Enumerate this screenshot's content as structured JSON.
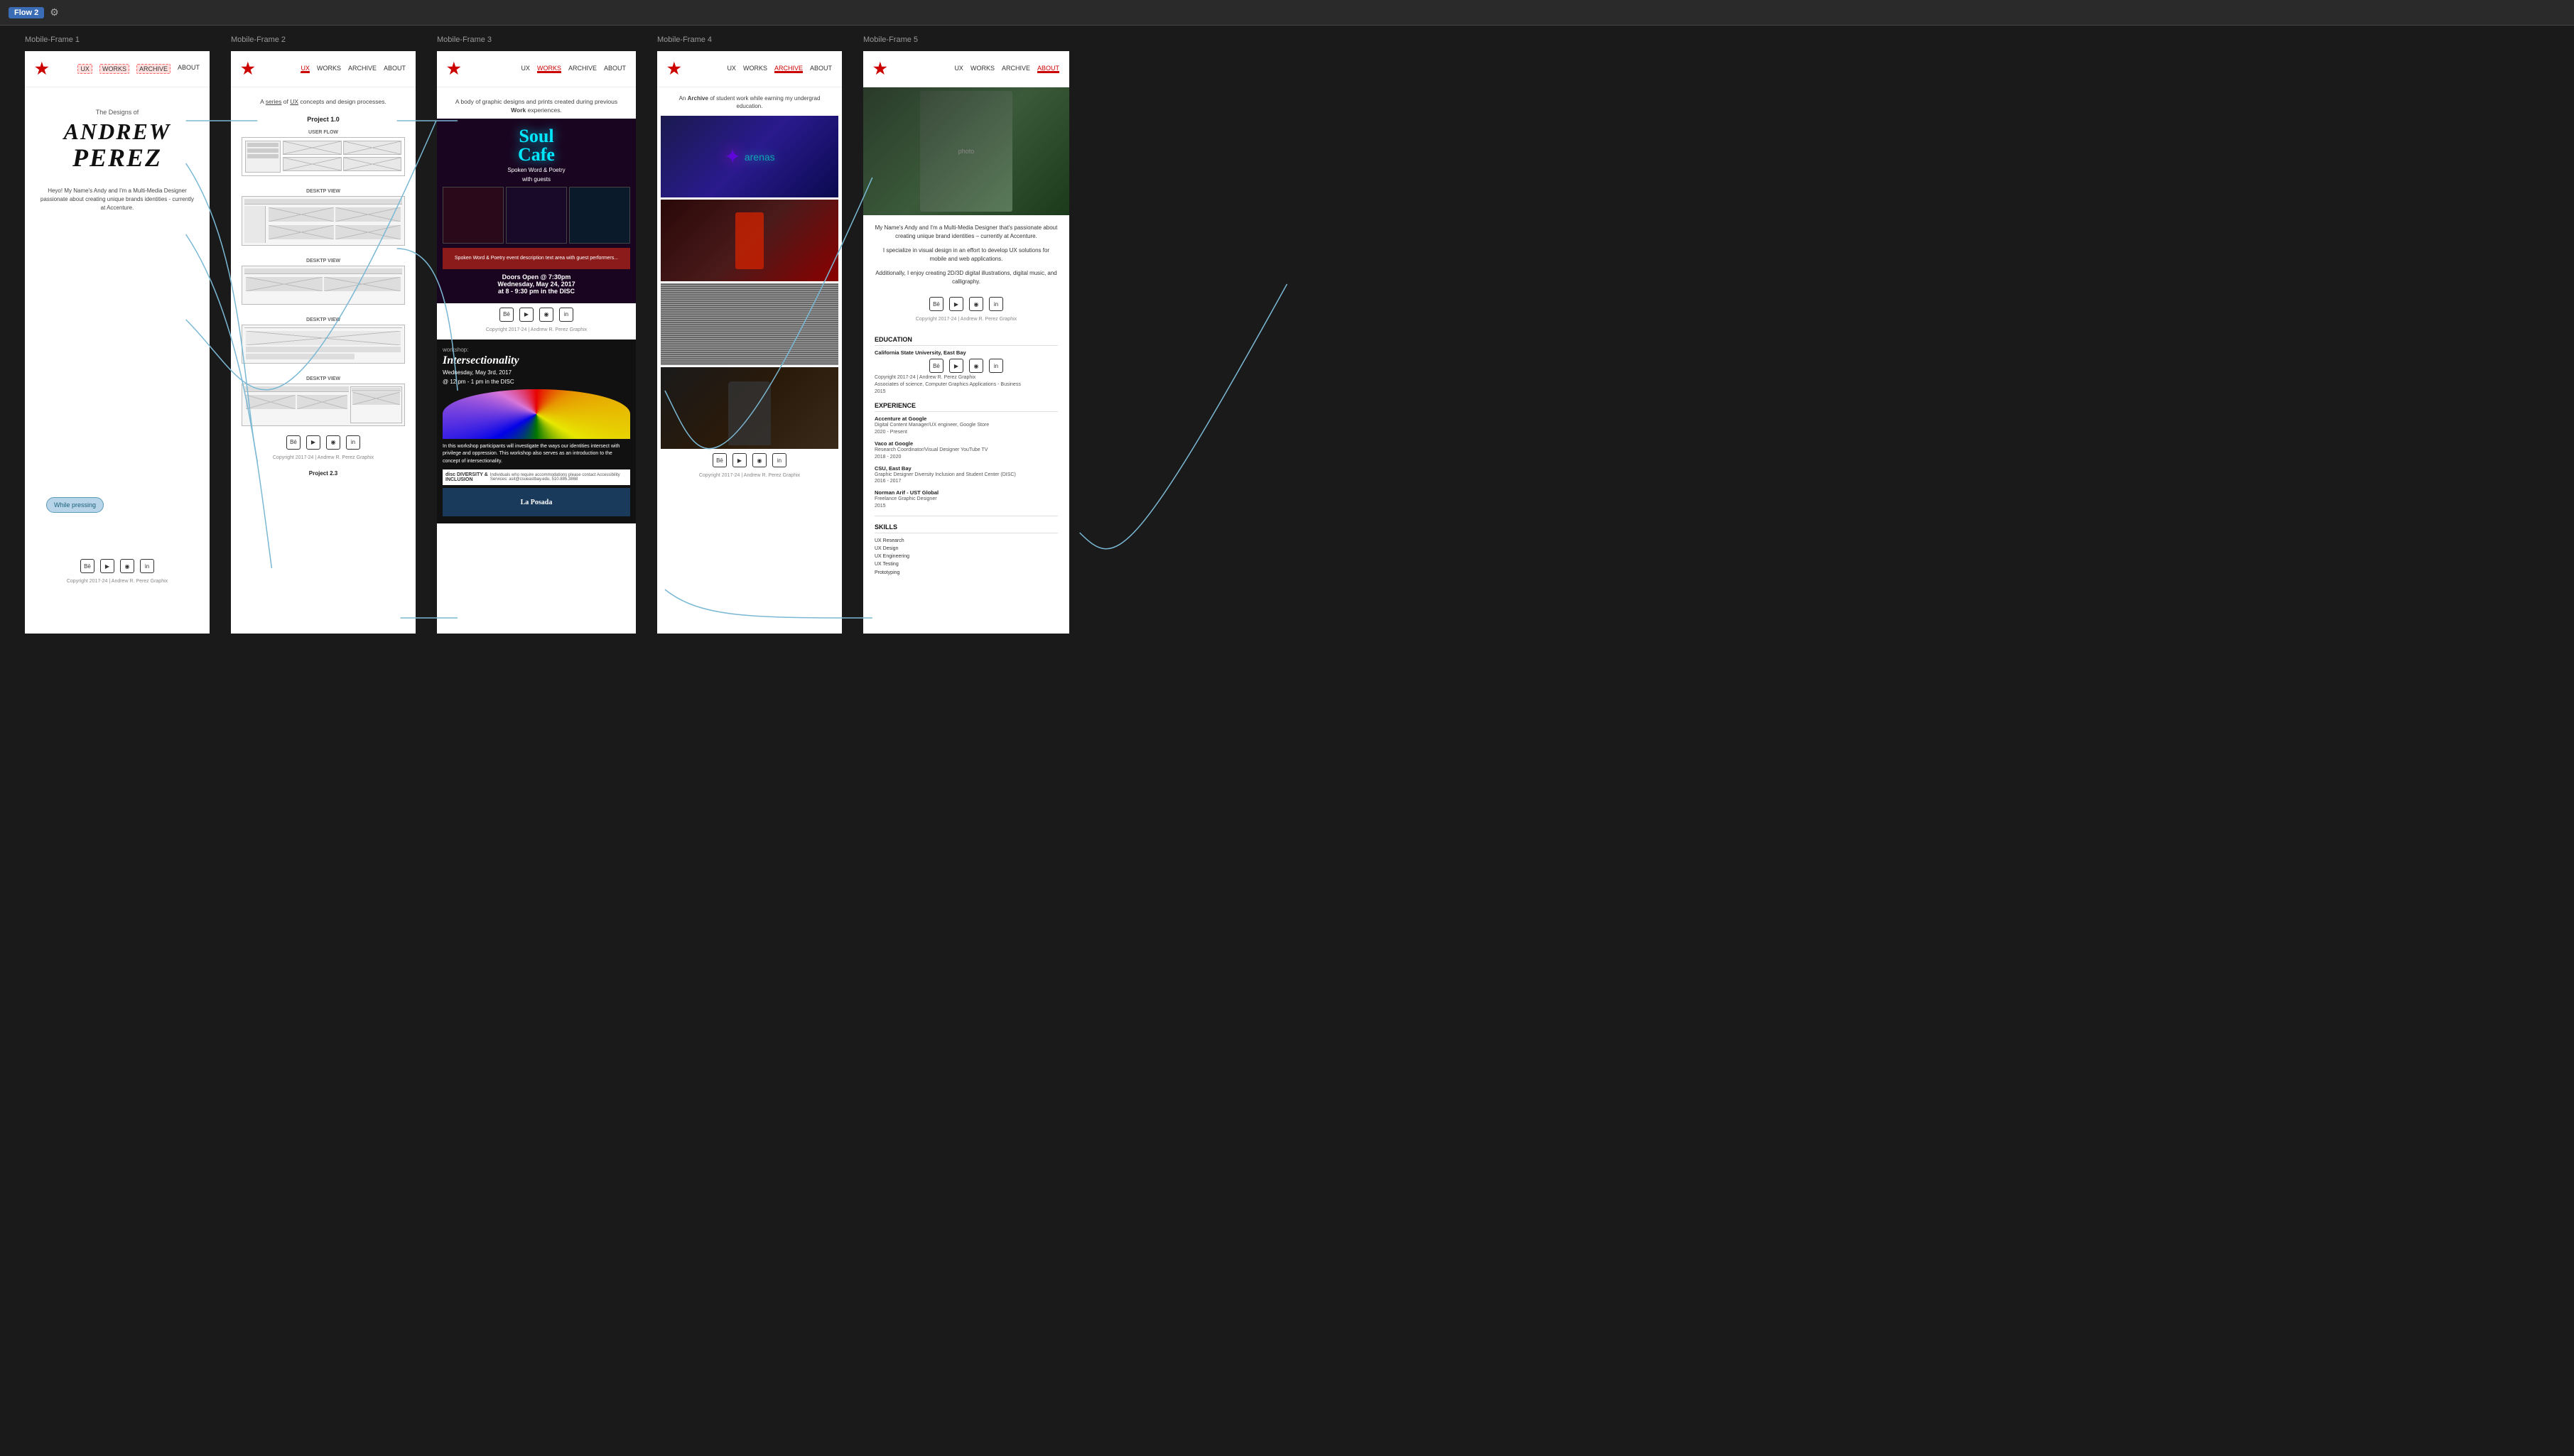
{
  "topbar": {
    "flow_label": "Flow 2",
    "flow_icon": "⚙"
  },
  "frames": [
    {
      "id": "frame1",
      "label": "Mobile-Frame 1",
      "nav": {
        "logo": "★",
        "links": [
          "UX",
          "WORKS",
          "ARCHIVE",
          "ABOUT"
        ]
      },
      "hero": {
        "small_text": "The Designs of",
        "name_line1": "ANDREW",
        "name_line2": "PEREZ",
        "description": "Heyo! My Name's Andy and I'm a Multi-Media Designer passionate about creating unique brands identities - currently at Accenture.",
        "while_pressing": "While pressing"
      },
      "social": [
        "Bē",
        "▶",
        "📷",
        "in"
      ],
      "copyright": "Copyright 2017-24 | Andrew R. Perez Graphix"
    },
    {
      "id": "frame2",
      "label": "Mobile-Frame 2",
      "nav": {
        "logo": "★",
        "links": [
          "UX",
          "WORKS",
          "ARCHIVE",
          "ABOUT"
        ],
        "active": "UX"
      },
      "intro": "A series of UX concepts and design processes.",
      "project_title": "Project 1.0",
      "sections": [
        {
          "label": "USER FLOW"
        },
        {
          "label": "DESKTP VIEW"
        },
        {
          "label": "DESKTP VIEW"
        },
        {
          "label": "DESKTP VIEW"
        },
        {
          "label": "DESKTP VIEW"
        }
      ],
      "social": [
        "Bē",
        "▶",
        "📷",
        "in"
      ],
      "copyright": "Copyright 2017-24 | Andrew R. Perez Graphix",
      "project2_label": "Project 2.3"
    },
    {
      "id": "frame3",
      "label": "Mobile-Frame 3",
      "nav": {
        "logo": "★",
        "links": [
          "UX",
          "WORKS",
          "ARCHIVE",
          "ABOUT"
        ],
        "active": "WORKS"
      },
      "intro": "A body of graphic designs and prints created during previous Work experiences.",
      "poster1": {
        "title": "Soul",
        "title2": "Cafe",
        "subtitle": "Spoken Word & Poetry",
        "subtitle2": "with guests",
        "doors_open": "Doors Open @ 7:30pm",
        "date": "Wednesday, May 24, 2017",
        "time": "at 8 - 9:30 pm in the DISC"
      },
      "poster2": {
        "workshop_label": "workshop:",
        "title": "Intersectionality",
        "date": "Wednesday, May 3rd, 2017",
        "time": "@ 12 pm - 1 pm in the DISC",
        "description": "In this workshop participants will investigate the ways our identities intersect with privilege and oppression. This workshop also serves as an introduction to the concept of intersectionality."
      },
      "social": [
        "Bē",
        "▶",
        "📷",
        "in"
      ],
      "copyright": "Copyright 2017-24 | Andrew R. Perez Graphix"
    },
    {
      "id": "frame4",
      "label": "Mobile-Frame 4",
      "nav": {
        "logo": "★",
        "links": [
          "UX",
          "WORKS",
          "ARCHIVE",
          "ABOUT"
        ],
        "active": "ARCHIVE"
      },
      "intro": "An Archive of student work while earning my undergrad education.",
      "social": [
        "Bē",
        "▶",
        "📷",
        "in"
      ],
      "copyright": "Copyright 2017-24 | Andrew R. Perez Graphix"
    },
    {
      "id": "frame5",
      "label": "Mobile-Frame 5",
      "nav": {
        "logo": "★",
        "links": [
          "UX",
          "WORKS",
          "ARCHIVE",
          "ABOUT"
        ],
        "active": "ABOUT"
      },
      "about": {
        "bio1": "My Name's Andy and I'm a Multi-Media Designer that's passionate about creating unique brand identities – currently at Accenture.",
        "bio2": "I specialize in visual design in an effort to develop UX solutions for mobile and web applications.",
        "bio3": "Additionally, I enjoy creating 2D/3D digital illustrations, digital music, and calligraphy.",
        "education_label": "EDUCATION",
        "edu1_school": "California State University, East Bay",
        "edu1_degree": "Associates of science, Computer Graphics Applications - Business",
        "edu1_year": "2015",
        "experience_label": "EXPERIENCE",
        "jobs": [
          {
            "company": "Accenture at Google",
            "role": "Digital Content Manager/UX engineer, Google Store",
            "years": "2020 - Present"
          },
          {
            "company": "Vaco at Google",
            "role": "Research Coordinator/Visual Designer YouTube TV",
            "years": "2018 - 2020"
          },
          {
            "company": "CSU, East Bay",
            "role": "Graphic Designer Diversity Inclusion and Student Center (DISC)",
            "years": "2016 - 2017"
          },
          {
            "company": "Norman Arif - UST Global",
            "role": "Freelance Graphic Designer",
            "years": "2015"
          }
        ],
        "skills_label": "SKILLS",
        "skills": [
          "UX Research",
          "UX Design",
          "UX Engineering",
          "UX Testing",
          "Prototyping"
        ]
      },
      "social": [
        "Bē",
        "▶",
        "📷",
        "in"
      ],
      "copyright": "Copyright 2017-24 | Andrew R. Perez Graphix"
    }
  ]
}
